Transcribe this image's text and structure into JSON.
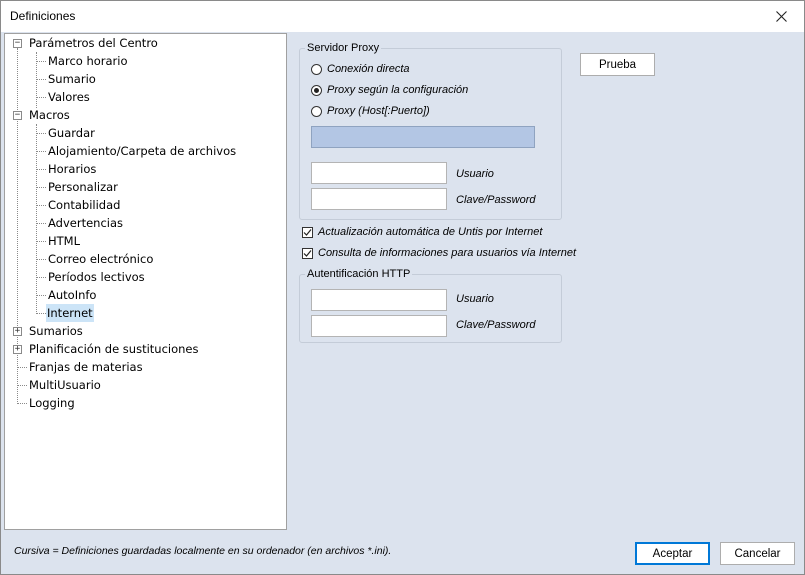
{
  "window": {
    "title": "Definiciones"
  },
  "tree": {
    "items": [
      {
        "label": "Parámetros del Centro",
        "expander": "−"
      },
      {
        "label": "Marco horario"
      },
      {
        "label": "Sumario"
      },
      {
        "label": "Valores"
      },
      {
        "label": "Macros",
        "expander": "−"
      },
      {
        "label": "Guardar"
      },
      {
        "label": "Alojamiento/Carpeta de archivos"
      },
      {
        "label": "Horarios"
      },
      {
        "label": "Personalizar"
      },
      {
        "label": "Contabilidad"
      },
      {
        "label": "Advertencias"
      },
      {
        "label": "HTML"
      },
      {
        "label": "Correo electrónico"
      },
      {
        "label": "Períodos lectivos"
      },
      {
        "label": "AutoInfo"
      },
      {
        "label": "Internet",
        "selected": true
      },
      {
        "label": "Sumarios",
        "expander": "+"
      },
      {
        "label": "Planificación de sustituciones",
        "expander": "+"
      },
      {
        "label": "Franjas de materias"
      },
      {
        "label": "MultiUsuario"
      },
      {
        "label": "Logging"
      }
    ]
  },
  "proxy": {
    "group_title": "Servidor Proxy",
    "options": [
      {
        "label": "Conexión directa",
        "selected": false
      },
      {
        "label": "Proxy según la configuración",
        "selected": true
      },
      {
        "label": "Proxy (Host[:Puerto])",
        "selected": false
      }
    ],
    "host_value": "",
    "user_label": "Usuario",
    "user_value": "",
    "password_label": "Clave/Password",
    "password_value": ""
  },
  "test_button": "Prueba",
  "checkboxes": [
    {
      "label": "Actualización automática de Untis por Internet",
      "checked": true
    },
    {
      "label": "Consulta de informaciones para usuarios vía Internet",
      "checked": true
    }
  ],
  "http_auth": {
    "group_title": "Autentificación HTTP",
    "user_label": "Usuario",
    "user_value": "",
    "password_label": "Clave/Password",
    "password_value": ""
  },
  "footer": {
    "note": "Cursiva = Definiciones guardadas localmente en su ordenador (en archivos *.ini).",
    "accept": "Aceptar",
    "cancel": "Cancelar"
  }
}
